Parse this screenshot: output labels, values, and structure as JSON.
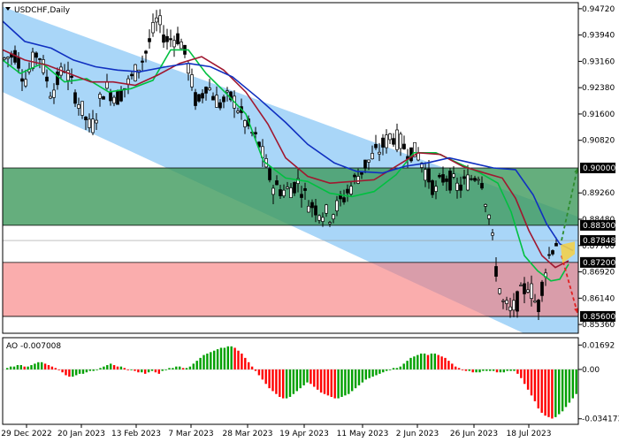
{
  "chart_data": {
    "type": "candlestick",
    "symbol": "USDCHF,Daily",
    "ylim": [
      0.851,
      0.949
    ],
    "y_ticks": [
      "0.94720",
      "0.93940",
      "0.93160",
      "0.92380",
      "0.91600",
      "0.90820",
      "0.89260",
      "0.88480",
      "0.87700",
      "0.86920",
      "0.86140",
      "0.85360"
    ],
    "x_ticks": [
      "29 Dec 2022",
      "20 Jan 2023",
      "13 Feb 2023",
      "7 Mar 2023",
      "28 Mar 2023",
      "19 Apr 2023",
      "11 May 2023",
      "2 Jun 2023",
      "26 Jun 2023",
      "18 Jul 2023"
    ],
    "price_levels": [
      {
        "value": 0.9,
        "label": "0.90000",
        "color": "#000000"
      },
      {
        "value": 0.883,
        "label": "0.88300",
        "color": "#000000"
      },
      {
        "value": 0.8785,
        "label": "0.87848",
        "color": "#000000"
      },
      {
        "value": 0.872,
        "label": "0.87200",
        "color": "#000000"
      },
      {
        "value": 0.856,
        "label": "0.85600",
        "color": "#000000"
      }
    ],
    "zones": [
      {
        "name": "resistance",
        "from": 0.883,
        "to": 0.9,
        "color": "#3e9a5c"
      },
      {
        "name": "support",
        "from": 0.856,
        "to": 0.872,
        "color": "#f77a7a"
      }
    ],
    "channel_color": "#8cc8f5",
    "series": [
      {
        "color": "#00c040",
        "points": [
          [
            0,
            0.932
          ],
          [
            20,
            0.928
          ],
          [
            45,
            0.931
          ],
          [
            70,
            0.9255
          ],
          [
            95,
            0.9265
          ],
          [
            120,
            0.9225
          ],
          [
            145,
            0.9235
          ],
          [
            170,
            0.926
          ],
          [
            190,
            0.935
          ],
          [
            210,
            0.935
          ],
          [
            230,
            0.928
          ],
          [
            255,
            0.9215
          ],
          [
            275,
            0.916
          ],
          [
            295,
            0.902
          ],
          [
            320,
            0.897
          ],
          [
            345,
            0.896
          ],
          [
            370,
            0.8925
          ],
          [
            395,
            0.8915
          ],
          [
            420,
            0.893
          ],
          [
            445,
            0.898
          ],
          [
            465,
            0.9045
          ],
          [
            490,
            0.9045
          ],
          [
            515,
            0.9015
          ],
          [
            540,
            0.8985
          ],
          [
            560,
            0.8955
          ],
          [
            575,
            0.887
          ],
          [
            590,
            0.874
          ],
          [
            605,
            0.8695
          ],
          [
            620,
            0.8665
          ],
          [
            630,
            0.867
          ],
          [
            640,
            0.8715
          ]
        ]
      },
      {
        "color": "#a01830",
        "points": [
          [
            0,
            0.935
          ],
          [
            25,
            0.932
          ],
          [
            50,
            0.9305
          ],
          [
            75,
            0.928
          ],
          [
            100,
            0.9255
          ],
          [
            125,
            0.9255
          ],
          [
            150,
            0.9245
          ],
          [
            175,
            0.9275
          ],
          [
            200,
            0.931
          ],
          [
            225,
            0.933
          ],
          [
            250,
            0.929
          ],
          [
            275,
            0.9225
          ],
          [
            300,
            0.913
          ],
          [
            320,
            0.903
          ],
          [
            345,
            0.8975
          ],
          [
            370,
            0.8955
          ],
          [
            395,
            0.896
          ],
          [
            420,
            0.8965
          ],
          [
            445,
            0.9005
          ],
          [
            470,
            0.9045
          ],
          [
            495,
            0.904
          ],
          [
            520,
            0.9005
          ],
          [
            545,
            0.8985
          ],
          [
            565,
            0.897
          ],
          [
            580,
            0.891
          ],
          [
            595,
            0.8815
          ],
          [
            610,
            0.874
          ],
          [
            625,
            0.8705
          ],
          [
            640,
            0.8725
          ]
        ]
      },
      {
        "color": "#1030c0",
        "points": [
          [
            0,
            0.9435
          ],
          [
            25,
            0.9375
          ],
          [
            55,
            0.9355
          ],
          [
            80,
            0.932
          ],
          [
            105,
            0.93
          ],
          [
            130,
            0.929
          ],
          [
            155,
            0.9285
          ],
          [
            185,
            0.93
          ],
          [
            210,
            0.931
          ],
          [
            235,
            0.93
          ],
          [
            260,
            0.927
          ],
          [
            290,
            0.9205
          ],
          [
            320,
            0.9135
          ],
          [
            345,
            0.907
          ],
          [
            375,
            0.9015
          ],
          [
            400,
            0.899
          ],
          [
            430,
            0.8985
          ],
          [
            455,
            0.9005
          ],
          [
            480,
            0.9015
          ],
          [
            505,
            0.903
          ],
          [
            530,
            0.9015
          ],
          [
            555,
            0.9
          ],
          [
            580,
            0.8995
          ],
          [
            600,
            0.892
          ],
          [
            615,
            0.8835
          ],
          [
            630,
            0.8775
          ],
          [
            645,
            0.8755
          ]
        ]
      }
    ],
    "price_path": [
      [
        0,
        0.932
      ],
      [
        15,
        0.934
      ],
      [
        25,
        0.926
      ],
      [
        40,
        0.935
      ],
      [
        55,
        0.922
      ],
      [
        70,
        0.93
      ],
      [
        85,
        0.92
      ],
      [
        100,
        0.911
      ],
      [
        115,
        0.924
      ],
      [
        130,
        0.921
      ],
      [
        145,
        0.926
      ],
      [
        160,
        0.933
      ],
      [
        175,
        0.944
      ],
      [
        185,
        0.938
      ],
      [
        200,
        0.939
      ],
      [
        210,
        0.93
      ],
      [
        220,
        0.918
      ],
      [
        230,
        0.925
      ],
      [
        245,
        0.919
      ],
      [
        260,
        0.921
      ],
      [
        275,
        0.913
      ],
      [
        290,
        0.907
      ],
      [
        305,
        0.895
      ],
      [
        320,
        0.893
      ],
      [
        335,
        0.896
      ],
      [
        345,
        0.89
      ],
      [
        360,
        0.887
      ],
      [
        370,
        0.886
      ],
      [
        380,
        0.889
      ],
      [
        395,
        0.895
      ],
      [
        410,
        0.901
      ],
      [
        425,
        0.905
      ],
      [
        440,
        0.91
      ],
      [
        455,
        0.906
      ],
      [
        470,
        0.904
      ],
      [
        480,
        0.898
      ],
      [
        490,
        0.893
      ],
      [
        500,
        0.898
      ],
      [
        515,
        0.894
      ],
      [
        530,
        0.897
      ],
      [
        540,
        0.899
      ],
      [
        550,
        0.886
      ],
      [
        558,
        0.87
      ],
      [
        565,
        0.86
      ],
      [
        575,
        0.857
      ],
      [
        585,
        0.862
      ],
      [
        595,
        0.866
      ],
      [
        605,
        0.858
      ],
      [
        612,
        0.868
      ],
      [
        620,
        0.876
      ],
      [
        628,
        0.879
      ]
    ],
    "projections": [
      {
        "direction": "up",
        "from": [
          632,
          0.8785
        ],
        "to": [
          650,
          0.9
        ],
        "color": "#2e8b2e",
        "style": "dashed"
      },
      {
        "direction": "down",
        "from": [
          632,
          0.874
        ],
        "to": [
          650,
          0.857
        ],
        "color": "#e02020",
        "style": "dashed"
      }
    ],
    "oscillator": {
      "label": "AO -0.007008",
      "ticks": [
        "0.01692",
        "0.00",
        "-0.034173"
      ],
      "ylim": [
        -0.038,
        0.022
      ],
      "values": [
        0.001,
        0.002,
        0.002,
        0.003,
        0.003,
        0.002,
        0.002,
        0.003,
        0.004,
        0.005,
        0.005,
        0.004,
        0.003,
        0.002,
        0.001,
        0.0,
        -0.002,
        -0.004,
        -0.005,
        -0.005,
        -0.004,
        -0.003,
        -0.003,
        -0.002,
        -0.001,
        -0.001,
        0.0,
        0.001,
        0.002,
        0.003,
        0.004,
        0.003,
        0.002,
        0.002,
        0.001,
        0.0,
        0.0,
        -0.001,
        -0.002,
        -0.002,
        -0.003,
        -0.002,
        -0.001,
        -0.002,
        -0.003,
        -0.001,
        0.0,
        0.001,
        0.001,
        0.002,
        0.002,
        0.001,
        0.001,
        0.002,
        0.004,
        0.006,
        0.008,
        0.01,
        0.011,
        0.012,
        0.013,
        0.014,
        0.015,
        0.015,
        0.016,
        0.016,
        0.015,
        0.013,
        0.011,
        0.008,
        0.005,
        0.002,
        -0.001,
        -0.004,
        -0.007,
        -0.01,
        -0.013,
        -0.015,
        -0.017,
        -0.019,
        -0.02,
        -0.02,
        -0.019,
        -0.017,
        -0.015,
        -0.013,
        -0.011,
        -0.009,
        -0.01,
        -0.012,
        -0.014,
        -0.016,
        -0.017,
        -0.018,
        -0.019,
        -0.02,
        -0.02,
        -0.019,
        -0.018,
        -0.017,
        -0.015,
        -0.013,
        -0.011,
        -0.009,
        -0.007,
        -0.006,
        -0.005,
        -0.004,
        -0.003,
        -0.002,
        -0.001,
        0.0,
        0.001,
        0.001,
        0.002,
        0.004,
        0.006,
        0.008,
        0.009,
        0.01,
        0.011,
        0.011,
        0.01,
        0.011,
        0.011,
        0.01,
        0.009,
        0.008,
        0.006,
        0.004,
        0.002,
        0.001,
        0.0,
        -0.001,
        -0.001,
        -0.002,
        -0.002,
        -0.002,
        -0.001,
        -0.001,
        -0.001,
        -0.001,
        -0.002,
        -0.002,
        -0.002,
        -0.001,
        -0.001,
        -0.001,
        -0.003,
        -0.006,
        -0.01,
        -0.014,
        -0.018,
        -0.022,
        -0.027,
        -0.03,
        -0.032,
        -0.033,
        -0.034,
        -0.033,
        -0.031,
        -0.029,
        -0.026,
        -0.023,
        -0.02,
        -0.017,
        -0.014,
        -0.011,
        -0.008
      ]
    }
  }
}
